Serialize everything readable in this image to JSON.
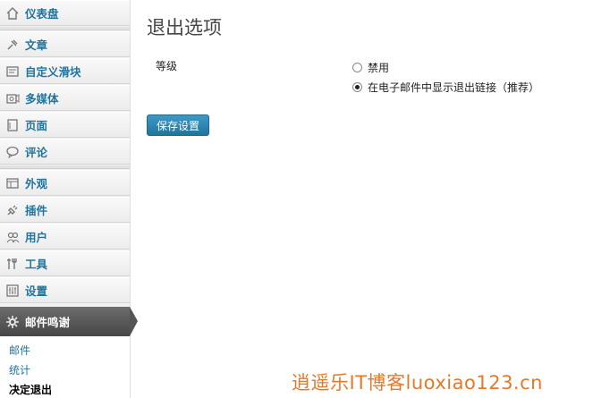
{
  "sidebar": {
    "items": [
      {
        "label": "仪表盘",
        "icon": "home-icon"
      },
      {
        "label": "文章",
        "icon": "pin-icon"
      },
      {
        "label": "自定义滑块",
        "icon": "slider-icon"
      },
      {
        "label": "多媒体",
        "icon": "media-icon"
      },
      {
        "label": "页面",
        "icon": "page-icon"
      },
      {
        "label": "评论",
        "icon": "comment-icon"
      },
      {
        "label": "外观",
        "icon": "appearance-icon"
      },
      {
        "label": "插件",
        "icon": "plugin-icon"
      },
      {
        "label": "用户",
        "icon": "users-icon"
      },
      {
        "label": "工具",
        "icon": "tools-icon"
      },
      {
        "label": "设置",
        "icon": "settings-icon"
      }
    ],
    "active": {
      "label": "邮件鸣谢",
      "icon": "gear-icon"
    },
    "submenu": [
      {
        "label": "邮件",
        "current": false
      },
      {
        "label": "统计",
        "current": false
      },
      {
        "label": "决定退出",
        "current": true
      }
    ]
  },
  "main": {
    "title": "退出选项",
    "level_label": "等级",
    "options": [
      {
        "label": "禁用",
        "checked": false
      },
      {
        "label": "在电子邮件中显示退出链接（推荐）",
        "checked": true
      }
    ],
    "save_label": "保存设置"
  },
  "watermark": "逍遥乐IT博客luoxiao123.cn",
  "colors": {
    "link": "#21759b",
    "button": "#21759b",
    "active_bg": "#464646",
    "watermark": "#e4792c"
  }
}
